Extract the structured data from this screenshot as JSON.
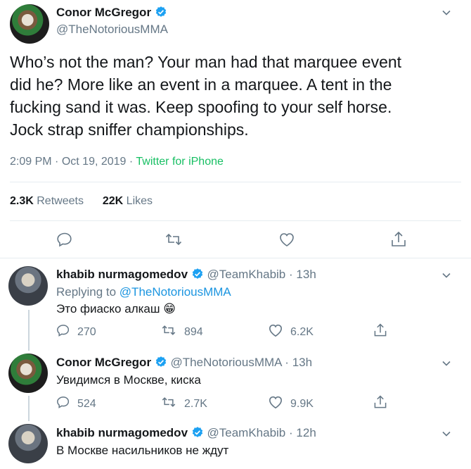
{
  "main_tweet": {
    "author_name": "Conor McGregor",
    "handle": "@TheNotoriousMMA",
    "text_lines": [
      "Who’s not the man? Your man had that marquee event",
      "did he? More like an event in a marquee. A tent in the",
      "fucking sand it was. Keep spoofing to your self horse.",
      "Jock strap sniffer championships."
    ],
    "time": "2:09 PM",
    "sep": "·",
    "date": "Oct 19, 2019",
    "source": "Twitter for iPhone",
    "retweets_count": "2.3K",
    "retweets_label": "Retweets",
    "likes_count": "22K",
    "likes_label": "Likes"
  },
  "replies": [
    {
      "author_name": "khabib nurmagomedov",
      "handle": "@TeamKhabib",
      "sep": "·",
      "time": "13h",
      "replying_prefix": "Replying to",
      "replying_to": "@TheNotoriousMMA",
      "text": "Это фиаско алкаш 😁",
      "reply_count": "270",
      "retweet_count": "894",
      "like_count": "6.2K"
    },
    {
      "author_name": "Conor McGregor",
      "handle": "@TheNotoriousMMA",
      "sep": "·",
      "time": "13h",
      "text": "Увидимся в Москве, киска",
      "reply_count": "524",
      "retweet_count": "2.7K",
      "like_count": "9.9K"
    },
    {
      "author_name": "khabib nurmagomedov",
      "handle": "@TeamKhabib",
      "sep": "·",
      "time": "12h",
      "text": "В Москве насильников не ждут"
    }
  ],
  "colors": {
    "link_blue": "#1b95e0",
    "source_green": "#17bf63",
    "muted": "#657786"
  }
}
